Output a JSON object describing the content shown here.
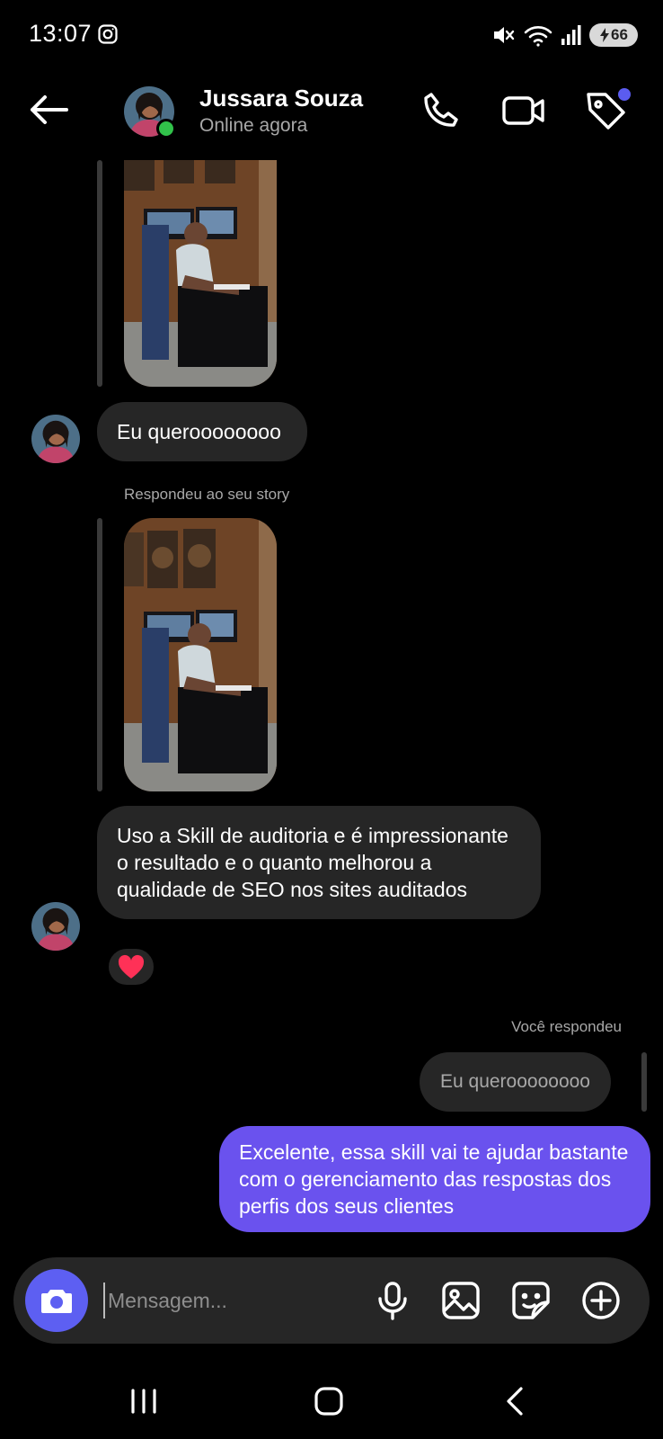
{
  "status_bar": {
    "time": "13:07",
    "battery": "66",
    "icons": [
      "instagram-icon",
      "mute-icon",
      "wifi-icon",
      "signal-icon",
      "battery-icon"
    ]
  },
  "header": {
    "contact_name": "Jussara Souza",
    "status": "Online agora",
    "icons": [
      "back-arrow-icon",
      "phone-icon",
      "video-camera-icon",
      "tag-icon"
    ]
  },
  "messages": {
    "msg1": "Eu queroooooooo",
    "story_caption": "Respondeu ao seu story",
    "msg2": "Uso a Skill de auditoria e é impressionante o resultado e o quanto melhorou a qualidade de SEO nos sites auditados",
    "reaction": "heart",
    "you_replied": "Você respondeu",
    "quoted": "Eu queroooooooo",
    "msg3": "Excelente, essa skill vai te ajudar bastante com o gerenciamento das respostas dos perfis dos seus clientes"
  },
  "composer": {
    "placeholder": "Mensagem...",
    "icons": [
      "camera-icon",
      "microphone-icon",
      "gallery-icon",
      "sticker-icon",
      "plus-icon"
    ]
  },
  "colors": {
    "background": "#000000",
    "incoming_bubble": "#262626",
    "outgoing_bubble": "#6a52ee",
    "camera_button": "#5d5ff2",
    "online": "#31c24a"
  }
}
